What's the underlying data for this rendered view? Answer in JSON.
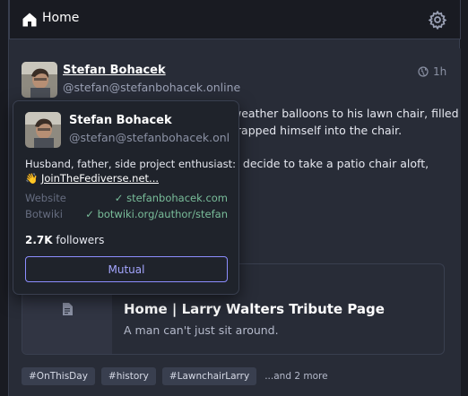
{
  "header": {
    "title": "Home"
  },
  "status": {
    "display_name": "Stefan Bohacek",
    "handle": "@stefan@stefanbohacek.online",
    "time": "1h",
    "text_lines": [
      "weather balloons to his lawn chair, filled",
      "trapped himself into the chair.",
      "n decide to take a patio chair aloft,"
    ]
  },
  "card": {
    "title": "Home | Larry Walters Tribute Page",
    "description": "A man can't just sit around."
  },
  "tags": [
    "#OnThisDay",
    "#history",
    "#LawnchairLarry"
  ],
  "tags_more": "...and 2 more",
  "popover": {
    "display_name": "Stefan Bohacek",
    "handle": "@stefan@stefanbohacek.onli...",
    "bio_line1": "Husband, father, side project enthusiast:",
    "bio_emoji": "👋",
    "bio_link": "JoinTheFediverse.net...",
    "fields": [
      {
        "name": "Website",
        "value": "stefanbohacek.com"
      },
      {
        "name": "Botwiki",
        "value": "botwiki.org/author/stefan"
      }
    ],
    "followers_count": "2.7K",
    "followers_label": "followers",
    "mutual_label": "Mutual"
  },
  "colors": {
    "background": "#191b22",
    "panel": "#282c37",
    "verified": "#79bd9a",
    "accent": "#8c8dff"
  },
  "icons": [
    "home-icon",
    "settings-icon",
    "globe-icon",
    "document-icon",
    "checkmark-icon"
  ]
}
